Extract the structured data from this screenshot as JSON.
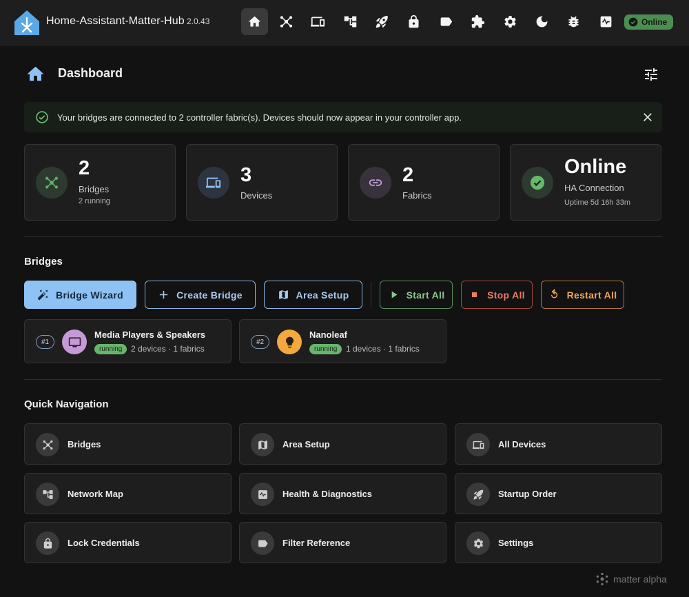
{
  "app": {
    "title": "Home-Assistant-Matter-Hub",
    "version": "2.0.43",
    "status": "Online",
    "nav_icons": [
      "home-icon",
      "bridges-icon",
      "devices-icon",
      "network-map-icon",
      "startup-rocket-icon",
      "lock-icon",
      "label-icon",
      "plugin-icon",
      "settings-icon",
      "dark-mode-icon",
      "bug-icon",
      "health-icon"
    ]
  },
  "page": {
    "title": "Dashboard"
  },
  "alert": {
    "text": "Your bridges are connected to 2 controller fabric(s). Devices should now appear in your controller app."
  },
  "stats": [
    {
      "value": "2",
      "label": "Bridges",
      "sub": "2 running",
      "icon": "bridge-icon",
      "color": "#5fb364"
    },
    {
      "value": "3",
      "label": "Devices",
      "sub": "",
      "icon": "devices-icon",
      "color": "#8fc2f4"
    },
    {
      "value": "2",
      "label": "Fabrics",
      "sub": "",
      "icon": "link-icon",
      "color": "#c9a3d8"
    },
    {
      "value": "Online",
      "label": "HA Connection",
      "sub": "Uptime 5d 16h 33m",
      "icon": "check-circle-icon",
      "color": "#67b86c"
    }
  ],
  "bridges_section": {
    "title": "Bridges",
    "buttons": {
      "wizard": "Bridge Wizard",
      "create": "Create Bridge",
      "area": "Area Setup",
      "start": "Start All",
      "stop": "Stop All",
      "restart": "Restart All"
    },
    "items": [
      {
        "num": "#1",
        "name": "Media Players & Speakers",
        "status": "running",
        "meta": "2 devices · 1 fabrics",
        "avatar_color": "#c79ad7"
      },
      {
        "num": "#2",
        "name": "Nanoleaf",
        "status": "running",
        "meta": "1 devices · 1 fabrics",
        "avatar_color": "#f3a93d"
      }
    ]
  },
  "quick_nav": {
    "title": "Quick Navigation",
    "items": [
      {
        "label": "Bridges",
        "icon": "bridge-icon"
      },
      {
        "label": "Area Setup",
        "icon": "map-icon"
      },
      {
        "label": "All Devices",
        "icon": "devices-icon"
      },
      {
        "label": "Network Map",
        "icon": "network-map-icon"
      },
      {
        "label": "Health & Diagnostics",
        "icon": "health-icon"
      },
      {
        "label": "Startup Order",
        "icon": "rocket-icon"
      },
      {
        "label": "Lock Credentials",
        "icon": "lock-icon"
      },
      {
        "label": "Filter Reference",
        "icon": "label-icon"
      },
      {
        "label": "Settings",
        "icon": "gear-icon"
      }
    ]
  },
  "footer": {
    "watermark": "matter alpha"
  }
}
